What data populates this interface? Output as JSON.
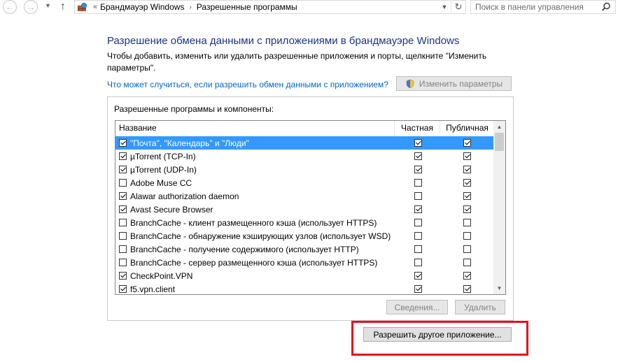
{
  "nav": {
    "breadcrumb_prefix": "«",
    "breadcrumbs": [
      "Брандмауэр Windows",
      "Разрешенные программы"
    ],
    "search_placeholder": "Поиск в панели управления"
  },
  "header": {
    "title": "Разрешение обмена данными с приложениями в брандмауэре Windows",
    "description": "Чтобы добавить, изменить или удалить разрешенные приложения и порты, щелкните \"Изменить параметры\".",
    "help_link": "Что может случиться, если разрешить обмен данными с приложением?",
    "change_settings_label": "Изменить параметры"
  },
  "panel": {
    "label": "Разрешенные программы и компоненты:",
    "columns": [
      "Название",
      "Частная",
      "Публичная"
    ],
    "rows": [
      {
        "name": "\"Почта\", \"Календарь\" и \"Люди\"",
        "enabled": true,
        "private": true,
        "public": true,
        "selected": true
      },
      {
        "name": "µTorrent (TCP-In)",
        "enabled": true,
        "private": true,
        "public": true,
        "selected": false
      },
      {
        "name": "µTorrent (UDP-In)",
        "enabled": true,
        "private": true,
        "public": true,
        "selected": false
      },
      {
        "name": "Adobe Muse CC",
        "enabled": false,
        "private": false,
        "public": true,
        "selected": false
      },
      {
        "name": "Alawar authorization daemon",
        "enabled": true,
        "private": false,
        "public": true,
        "selected": false
      },
      {
        "name": "Avast Secure Browser",
        "enabled": true,
        "private": true,
        "public": true,
        "selected": false
      },
      {
        "name": "BranchCache - клиент размещенного кэша (использует HTTPS)",
        "enabled": false,
        "private": false,
        "public": false,
        "selected": false
      },
      {
        "name": "BranchCache - обнаружение кэширующих узлов (использует WSD)",
        "enabled": false,
        "private": false,
        "public": false,
        "selected": false
      },
      {
        "name": "BranchCache - получение содержимого (использует HTTP)",
        "enabled": false,
        "private": false,
        "public": false,
        "selected": false
      },
      {
        "name": "BranchCache - сервер размещенного кэша (использует HTTPS)",
        "enabled": false,
        "private": false,
        "public": false,
        "selected": false
      },
      {
        "name": "CheckPoint.VPN",
        "enabled": true,
        "private": true,
        "public": true,
        "selected": false
      },
      {
        "name": "f5.vpn.client",
        "enabled": true,
        "private": true,
        "public": true,
        "selected": false
      }
    ],
    "details_label": "Сведения...",
    "delete_label": "Удалить"
  },
  "allow_another_label": "Разрешить другое приложение...",
  "colors": {
    "title": "#1e3287",
    "link": "#0066cc",
    "selection": "#3399ff",
    "highlight_border": "#e3131c"
  }
}
